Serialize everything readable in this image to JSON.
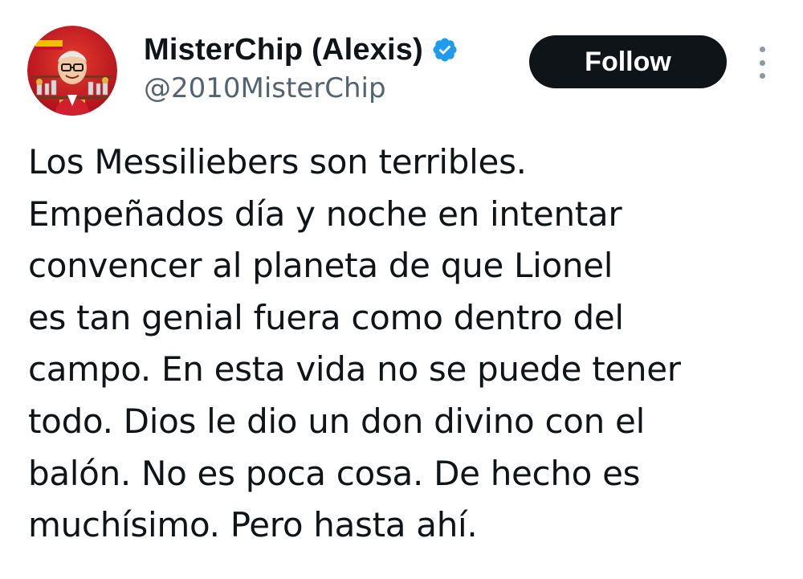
{
  "user": {
    "display_name": "MisterChip (Alexis)",
    "handle": "@2010MisterChip",
    "verified_icon": "verified-badge-icon",
    "avatar": "avatar-caricature-with-trophies"
  },
  "actions": {
    "follow_label": "Follow",
    "more_icon": "more-vertical-icon"
  },
  "tweet": {
    "lines": [
      "Los Messiliebers son terribles.",
      "Empeñados día y noche en intentar",
      "convencer al planeta de que Lionel",
      "es tan genial fuera como dentro del",
      "campo. En esta vida no se puede tener",
      "todo. Dios le dio un don divino con el",
      "balón. No es poca cosa. De hecho es",
      "muchísimo. Pero hasta ahí."
    ]
  },
  "colors": {
    "text_primary": "#0f1419",
    "text_secondary": "#536471",
    "verified_blue": "#1d9bf0",
    "follow_bg": "#0f1419",
    "avatar_bg": "#c8102e"
  }
}
